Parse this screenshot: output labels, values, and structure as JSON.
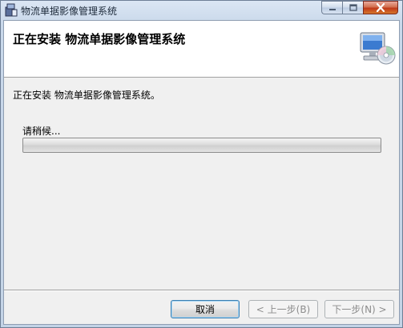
{
  "window": {
    "title": "物流单据影像管理系统"
  },
  "banner": {
    "heading": "正在安装 物流单据影像管理系统"
  },
  "body": {
    "status_text": "正在安装 物流单据影像管理系统。",
    "wait_text": "请稍候...",
    "progress_percent": 0
  },
  "buttons": {
    "cancel": "取消",
    "back": "< 上一步(B)",
    "next": "下一步(N) >"
  },
  "icons": {
    "app": "installer-icon",
    "banner": "computer-cd-icon",
    "minimize": "minimize-icon",
    "maximize": "maximize-icon",
    "close": "close-icon"
  }
}
